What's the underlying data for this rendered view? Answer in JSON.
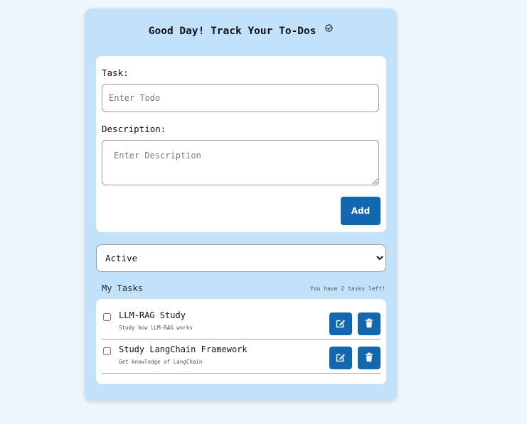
{
  "header": {
    "title": "Good Day! Track Your To-Dos"
  },
  "form": {
    "task_label": "Task:",
    "task_placeholder": "Enter Todo",
    "task_value": "",
    "description_label": "Description:",
    "description_placeholder": "Enter Description",
    "description_value": "",
    "add_label": "Add"
  },
  "filter": {
    "selected": "Active",
    "options": [
      "Active"
    ]
  },
  "tasks_section": {
    "heading": "My Tasks",
    "remaining_text": "You have 2 tasks left!"
  },
  "tasks": [
    {
      "title": "LLM-RAG Study",
      "description": "Study how LLM-RAG works",
      "completed": false
    },
    {
      "title": "Study LangChain Framework",
      "description": "Get knowledge of LangChain",
      "completed": false
    }
  ],
  "colors": {
    "page_background": "#eef6fd",
    "app_background": "#c2e2fb",
    "accent": "#1168b0"
  },
  "icons": {
    "title_icon": "check-circle-icon",
    "edit_icon": "edit-icon",
    "delete_icon": "trash-icon"
  }
}
